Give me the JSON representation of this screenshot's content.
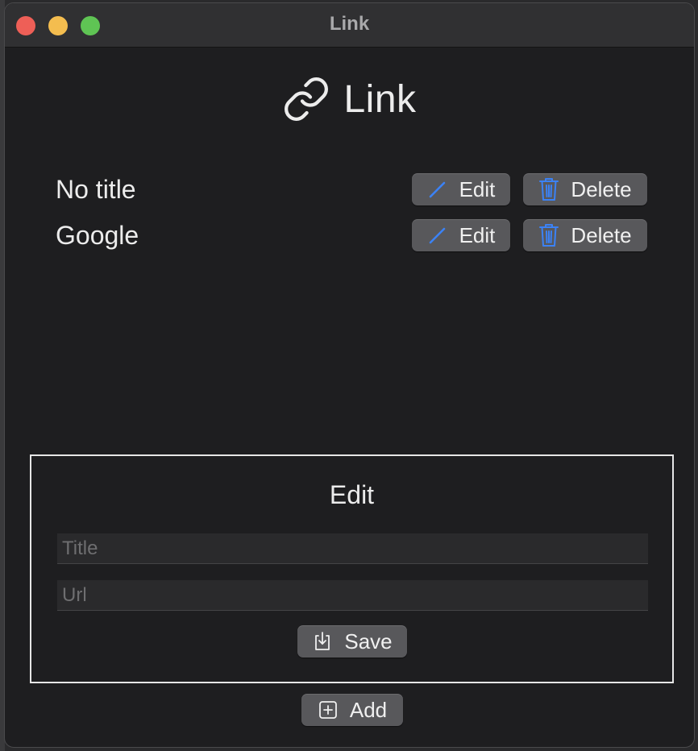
{
  "window": {
    "title": "Link"
  },
  "header": {
    "title": "Link",
    "icon": "link-icon"
  },
  "links": [
    {
      "title": "No title",
      "edit_label": "Edit",
      "delete_label": "Delete"
    },
    {
      "title": "Google",
      "edit_label": "Edit",
      "delete_label": "Delete"
    }
  ],
  "edit_panel": {
    "title": "Edit",
    "title_field": {
      "value": "",
      "placeholder": "Title"
    },
    "url_field": {
      "value": "",
      "placeholder": "Url"
    },
    "save_label": "Save"
  },
  "add_label": "Add",
  "colors": {
    "accent_icon": "#3b82f6",
    "button_bg": "#58585b",
    "window_bg": "#1e1e20"
  }
}
